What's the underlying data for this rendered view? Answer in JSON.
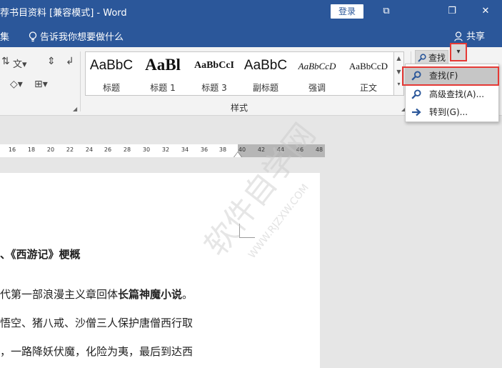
{
  "titlebar": {
    "title": "荐书目资料 [兼容模式]  -  Word",
    "login_label": "登录",
    "restore_glyph": "⧉",
    "maximize_glyph": "❐",
    "close_glyph": "✕"
  },
  "menubar": {
    "collect_label": "集",
    "tellme_text": "告诉我你想要做什么",
    "share_label": "共享"
  },
  "ribbon": {
    "styles_group_label": "样式",
    "styles": [
      {
        "sample": "AaBbC",
        "name": "标题"
      },
      {
        "sample": "AaBl",
        "name": "标题 1"
      },
      {
        "sample": "AaBbCcI",
        "name": "标题 3"
      },
      {
        "sample": "AaBbC",
        "name": "副标题"
      },
      {
        "sample": "AaBbCcD",
        "name": "强调"
      },
      {
        "sample": "AaBbCcD",
        "name": "正文"
      }
    ],
    "find_button_label": "查找",
    "find_dropdown_glyph": "▾"
  },
  "find_menu": {
    "items": [
      {
        "label": "查找(F)",
        "highlighted": true,
        "icon": "search-icon"
      },
      {
        "label": "高级查找(A)...",
        "highlighted": false,
        "icon": "search-icon"
      },
      {
        "label": "转到(G)...",
        "highlighted": false,
        "icon": "arrow-right-icon"
      }
    ]
  },
  "ruler": {
    "ticks": [
      "16",
      "18",
      "20",
      "22",
      "24",
      "26",
      "28",
      "30",
      "32",
      "34",
      "36",
      "38",
      "40",
      "42",
      "44",
      "46",
      "48"
    ]
  },
  "document": {
    "heading": "、《西游记》梗概",
    "line1_normal": "代第一部浪漫主义章回体",
    "line1_bold": "长篇神魔小说",
    "line1_end": "。",
    "line2": "悟空、猪八戒、沙僧三人保护唐僧西行取",
    "line3": "，一路降妖伏魔，化险为夷，最后到达西"
  },
  "watermark": {
    "text": "软件自学网",
    "url": "WWW.RJZXW.COM"
  },
  "colors": {
    "accent": "#2b579a",
    "highlight_outline": "#e53935",
    "menu_highlight": "#c6c6c6"
  }
}
